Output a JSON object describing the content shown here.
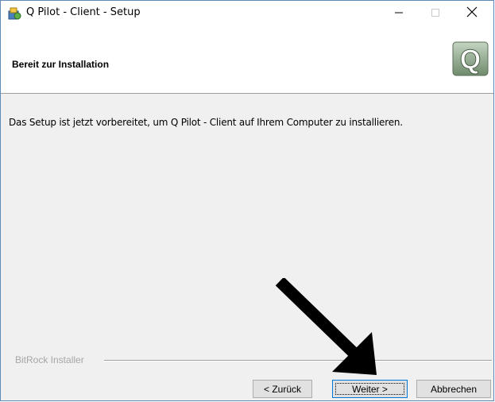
{
  "window": {
    "title": "Q Pilot - Client - Setup",
    "minimize_icon": "minimize-icon",
    "maximize_icon": "maximize-icon",
    "close_icon": "close-icon"
  },
  "header": {
    "title": "Bereit zur Installation",
    "logo_letter": "Q"
  },
  "content": {
    "message": "Das Setup ist jetzt vorbereitet, um Q Pilot - Client auf Ihrem Computer zu installieren."
  },
  "footer": {
    "brand": "BitRock Installer",
    "back_label": "< Zurück",
    "next_label": "Weiter >",
    "cancel_label": "Abbrechen"
  },
  "colors": {
    "window_border": "#5f8ab8",
    "dialog_bg": "#f0f0f0",
    "logo_green": "#7d9a7a",
    "focus_blue": "#0078d7"
  }
}
